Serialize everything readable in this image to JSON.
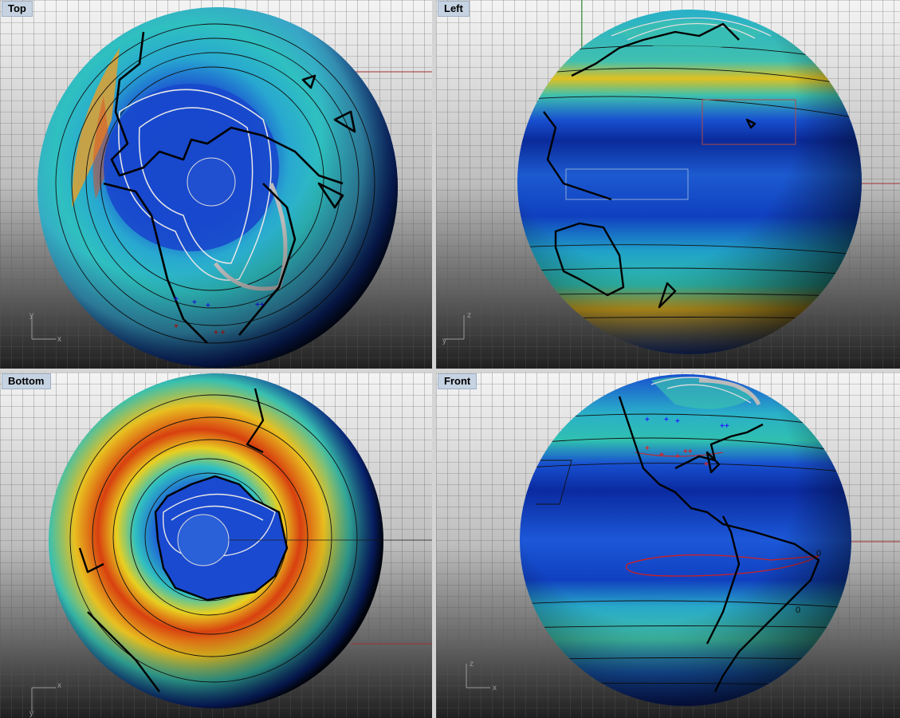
{
  "viewports": [
    {
      "id": "top",
      "title": "Top",
      "axis": {
        "h": "x",
        "v": "y"
      }
    },
    {
      "id": "left",
      "title": "Left",
      "axis": {
        "h": "y",
        "v": "z"
      }
    },
    {
      "id": "bottom",
      "title": "Bottom",
      "axis": {
        "h": "x",
        "v": "y"
      }
    },
    {
      "id": "front",
      "title": "Front",
      "axis": {
        "h": "x",
        "v": "z"
      }
    }
  ],
  "contour_labels": {
    "front_a": "0",
    "front_b": "0"
  },
  "colors": {
    "bg_top": "#f2f2f2",
    "bg_bottom": "#1c1c1c",
    "grid": "#555555",
    "ocean_low": "#0a2a9a",
    "mid": "#28b8c8",
    "high": "#f0e020",
    "hot": "#d84010"
  }
}
